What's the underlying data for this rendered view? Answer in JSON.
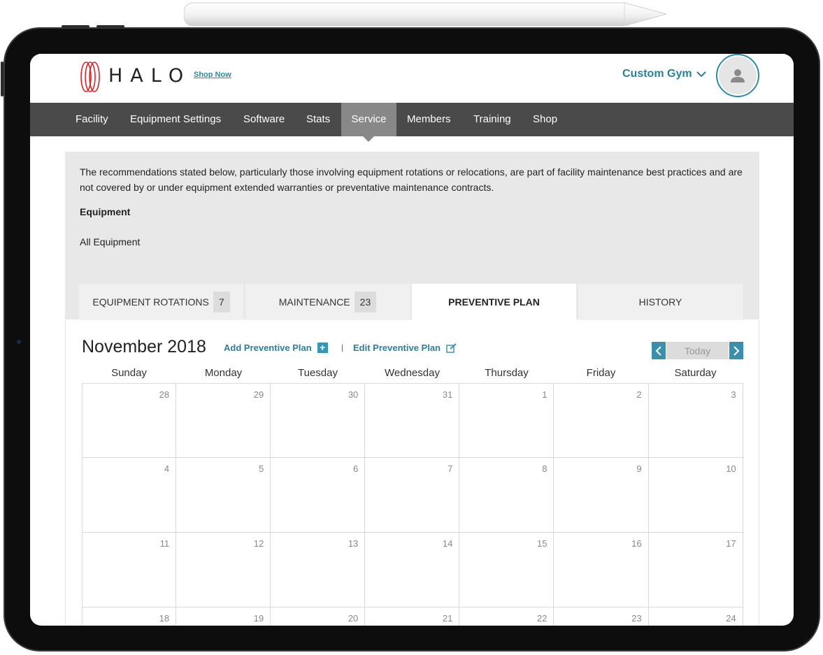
{
  "header": {
    "brand": "HALO",
    "shop_link": "Shop Now",
    "facility_selector": "Custom Gym",
    "icons": {
      "logo": "halo-rings-logo",
      "dropdown": "chevron-down-icon",
      "avatar": "user-icon"
    }
  },
  "nav": {
    "items": [
      {
        "label": "Facility"
      },
      {
        "label": "Equipment Settings"
      },
      {
        "label": "Software"
      },
      {
        "label": "Stats"
      },
      {
        "label": "Service",
        "active": true
      },
      {
        "label": "Members"
      },
      {
        "label": "Training"
      },
      {
        "label": "Shop"
      }
    ]
  },
  "info": {
    "disclaimer": "The recommendations stated below, particularly those involving equipment rotations or relocations, are part of facility maintenance best practices and are not covered by or under equipment extended warranties or preventative maintenance contracts.",
    "equipment_heading": "Equipment",
    "equipment_value": "All Equipment"
  },
  "tabs": [
    {
      "label": "EQUIPMENT ROTATIONS",
      "count": "7"
    },
    {
      "label": "MAINTENANCE",
      "count": "23"
    },
    {
      "label": "PREVENTIVE PLAN",
      "active": true
    },
    {
      "label": "HISTORY"
    }
  ],
  "calendar": {
    "month_title": "November 2018",
    "add_plan": "Add Preventive Plan",
    "separator": "|",
    "edit_plan": "Edit Preventive Plan",
    "today": "Today",
    "weekdays": [
      "Sunday",
      "Monday",
      "Tuesday",
      "Wednesday",
      "Thursday",
      "Friday",
      "Saturday"
    ],
    "weeks": [
      [
        "28",
        "29",
        "30",
        "31",
        "1",
        "2",
        "3"
      ],
      [
        "4",
        "5",
        "6",
        "7",
        "8",
        "9",
        "10"
      ],
      [
        "11",
        "12",
        "13",
        "14",
        "15",
        "16",
        "17"
      ],
      [
        "18",
        "19",
        "20",
        "21",
        "22",
        "23",
        "24"
      ]
    ]
  },
  "colors": {
    "accent": "#2b7f9a",
    "nav_bg": "#4a4a4a",
    "nav_active": "#888888",
    "panel_bg": "#e8e8e8",
    "logo_red": "#d9252b"
  }
}
